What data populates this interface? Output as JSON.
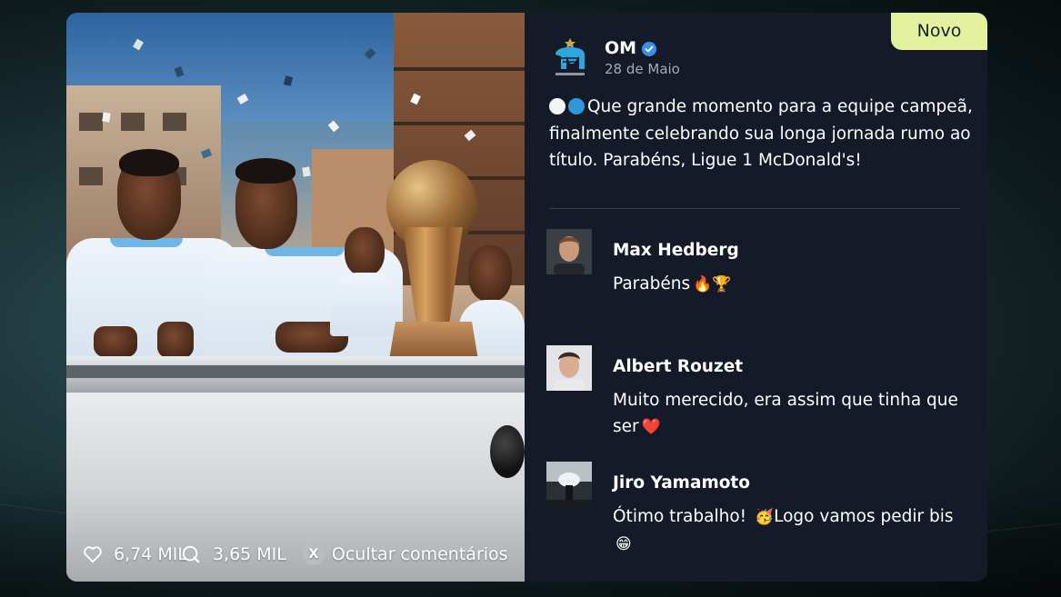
{
  "post": {
    "badge": "Novo",
    "author": "OM",
    "date": "28 de Maio",
    "text": "Que grande momento para a equipe campeã, finalmente celebrando sua longa jornada rumo ao título. Parabéns, Ligue 1 McDonald's!"
  },
  "stats": {
    "likes": "6,74 MIL",
    "comments": "3,65 MIL",
    "hide_comments_key": "X",
    "hide_comments_label": "Ocultar comentários"
  },
  "comments": [
    {
      "name": "Max Hedberg",
      "text": "Parabéns",
      "emojis": "🔥🏆"
    },
    {
      "name": "Albert Rouzet",
      "text": "Muito merecido, era assim que tinha que ser",
      "emojis": "❤️"
    },
    {
      "name": "Jiro Yamamoto",
      "text_a": "Ótimo trabalho!",
      "emoji_mid": "🥳",
      "text_b": "Logo vamos pedir bis",
      "emoji_end": "😁"
    }
  ],
  "colors": {
    "badge_bg": "#e4f2a0",
    "card_bg": "#141a27",
    "verified": "#3d8ee8",
    "om_blue": "#2fa6de"
  }
}
